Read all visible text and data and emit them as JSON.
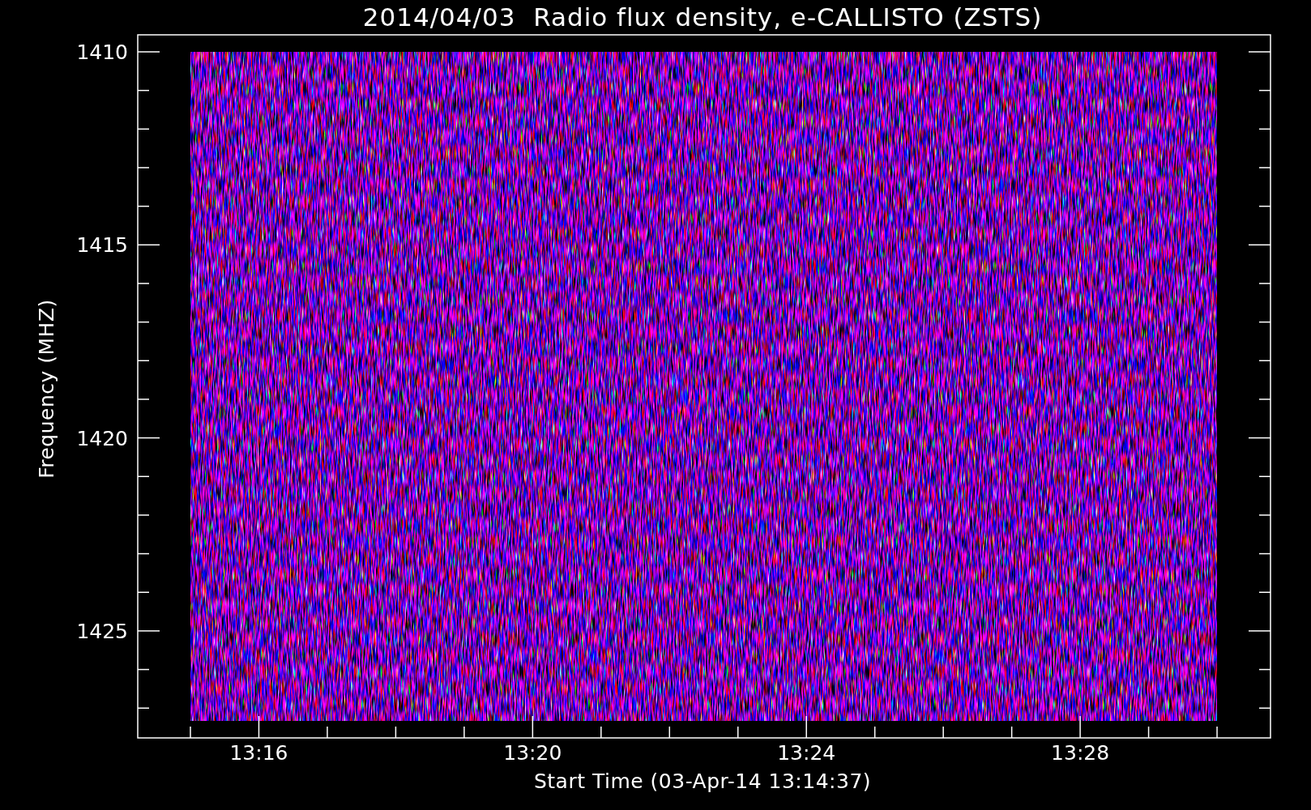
{
  "title": "2014/04/03  Radio flux density, e-CALLISTO (ZSTS)",
  "y_axis": {
    "label": "Frequency (MHZ)",
    "ticks": [
      "1410",
      "1415",
      "1420",
      "1425"
    ]
  },
  "x_axis": {
    "label": "Start Time (03-Apr-14 13:14:37)",
    "ticks": [
      "13:16",
      "13:20",
      "13:24",
      "13:28"
    ]
  }
}
